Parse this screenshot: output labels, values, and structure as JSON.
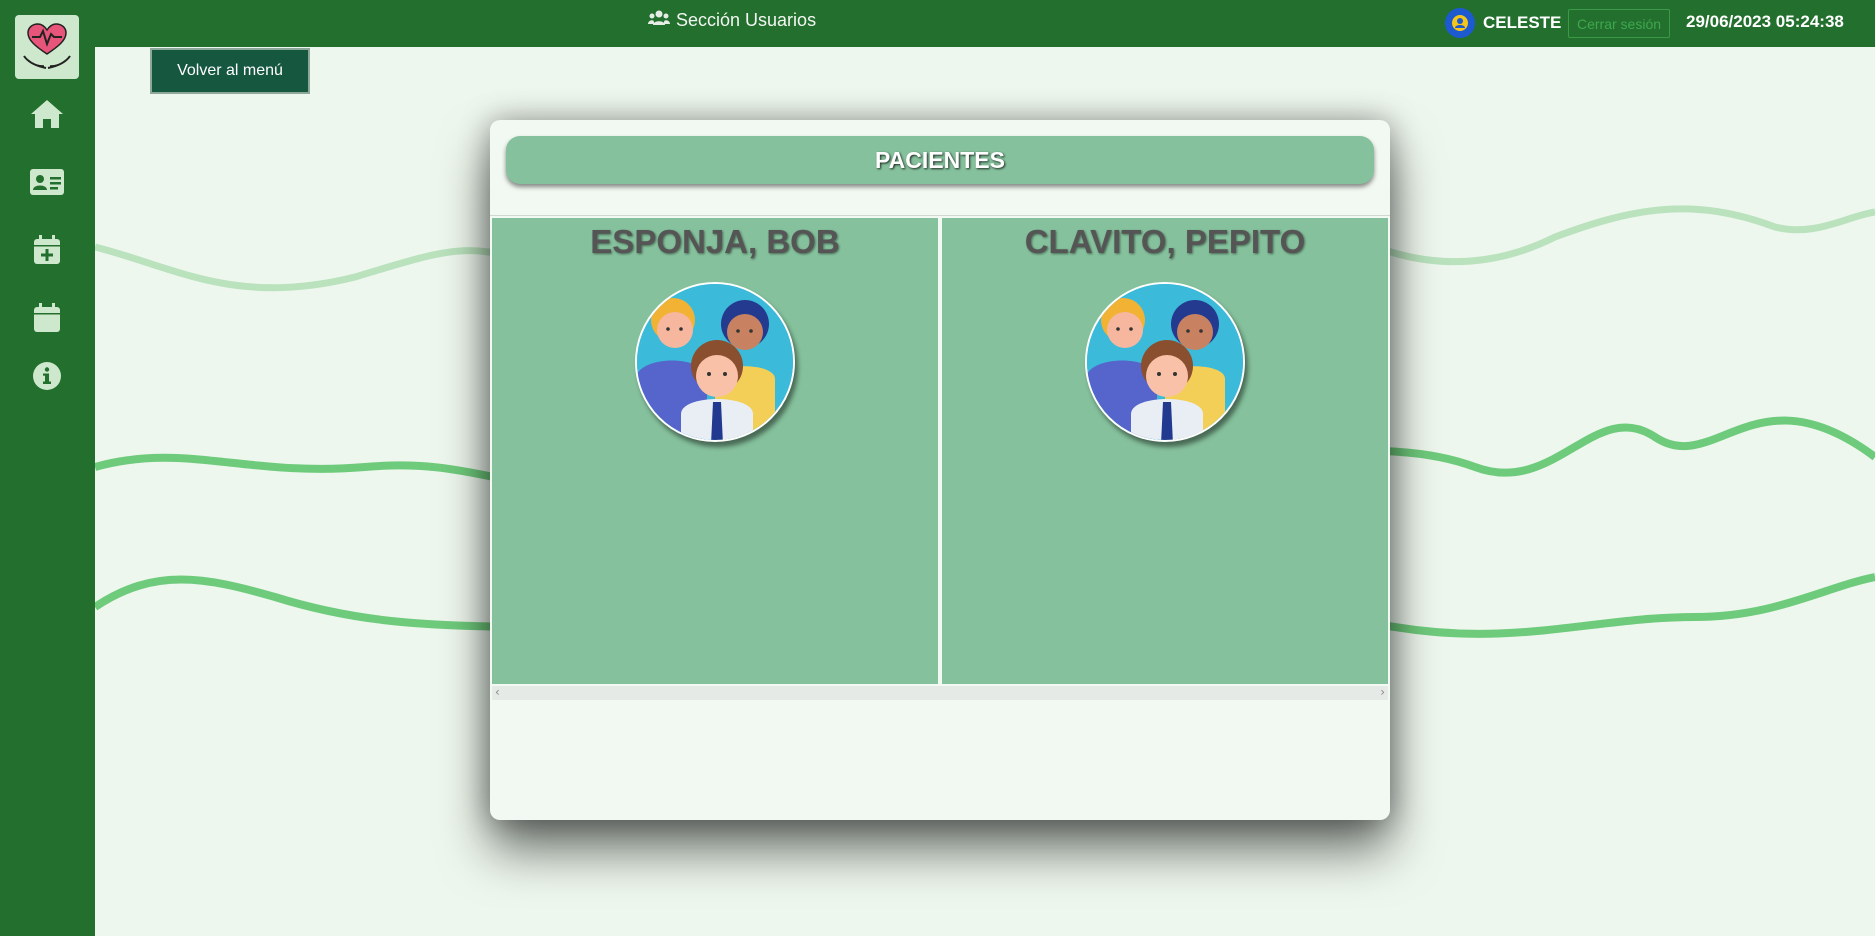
{
  "app": {
    "section_title": "Sección Usuarios",
    "username": "CELESTE",
    "logout_label": "Cerrar sesión",
    "datetime": "29/06/2023 05:24:38"
  },
  "sidebar": {
    "items": [
      {
        "name": "home-icon"
      },
      {
        "name": "id-card-icon"
      },
      {
        "name": "calendar-plus-icon"
      },
      {
        "name": "calendar-icon"
      },
      {
        "name": "info-icon"
      }
    ]
  },
  "back_button": {
    "label": "Volver al menú"
  },
  "modal": {
    "title": "PACIENTES",
    "patients": [
      {
        "name": "ESPONJA, BOB"
      },
      {
        "name": "CLAVITO, PEPITO"
      }
    ]
  },
  "colors": {
    "nav_green": "#236f2d",
    "card_green": "#85c19c",
    "back_button": "#15573f",
    "background": "#eef7ee"
  }
}
